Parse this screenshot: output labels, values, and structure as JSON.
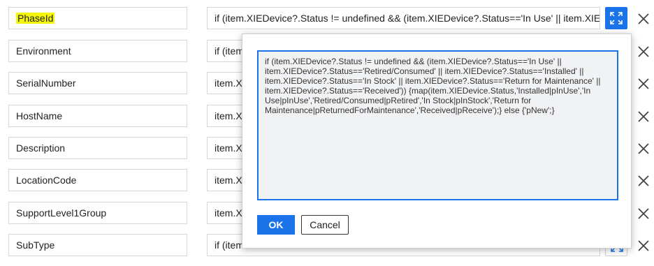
{
  "fields": [
    {
      "name": "PhaseId",
      "expr": "if (item.XIEDevice?.Status != undefined && (item.XIEDevice?.Status=='In Use' || item.XIEDevice?.Status=='Retired/Consumed'"
    },
    {
      "name": "Environment",
      "expr": "if (item"
    },
    {
      "name": "SerialNumber",
      "expr": "item.XI"
    },
    {
      "name": "HostName",
      "expr": "item.XI"
    },
    {
      "name": "Description",
      "expr": "item.XI"
    },
    {
      "name": "LocationCode",
      "expr": "item.XI"
    },
    {
      "name": "SupportLevel1Group",
      "expr": "item.XI"
    },
    {
      "name": "SubType",
      "expr": "if (item"
    }
  ],
  "dialog": {
    "expression": "if (item.XIEDevice?.Status != undefined && (item.XIEDevice?.Status=='In Use' || item.XIEDevice?.Status=='Retired/Consumed' || item.XIEDevice?.Status=='Installed' || item.XIEDevice?.Status=='In Stock' || item.XIEDevice?.Status=='Return for Maintenance' || item.XIEDevice?.Status=='Received')) {map(item.XIEDevice.Status,'Installed|pInUse','In Use|pInUse','Retired/Consumed|pRetired','In Stock|pInStock','Return for Maintenance|pReturnedForMaintenance','Received|pReceive');} else {'pNew';}",
    "ok_label": "OK",
    "cancel_label": "Cancel"
  },
  "colors": {
    "accent": "#1a73e8",
    "highlight": "#f3f60a"
  },
  "icons": {
    "expand": "expand-arrows-icon",
    "remove": "close-icon"
  }
}
